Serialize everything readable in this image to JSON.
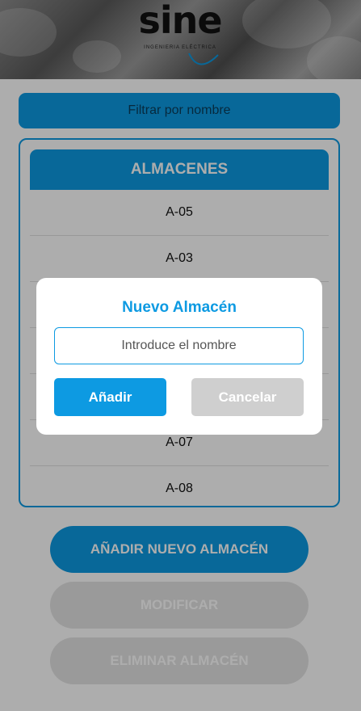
{
  "header": {
    "logo_text": "sine",
    "logo_subtext": "INGENIERIA ELÉCTRICA"
  },
  "filter": {
    "placeholder": "Filtrar por nombre"
  },
  "list": {
    "title": "ALMACENES",
    "items": [
      {
        "label": "A-05"
      },
      {
        "label": "A-03"
      },
      {
        "label": ""
      },
      {
        "label": ""
      },
      {
        "label": ""
      },
      {
        "label": "A-07"
      },
      {
        "label": "A-08"
      }
    ]
  },
  "actions": {
    "add_new_label": "AÑADIR NUEVO ALMACÉN",
    "modify_label": "MODIFICAR",
    "delete_label": "ELIMINAR ALMACÉN"
  },
  "dialog": {
    "title": "Nuevo Almacén",
    "input_placeholder": "Introduce el nombre",
    "input_value": "",
    "confirm_label": "Añadir",
    "cancel_label": "Cancelar"
  },
  "colors": {
    "accent": "#0d9ae2",
    "disabled": "#e3e3e3",
    "cancel": "#cfcfcf"
  },
  "icons": {
    "logo": "sine-logo-icon"
  }
}
